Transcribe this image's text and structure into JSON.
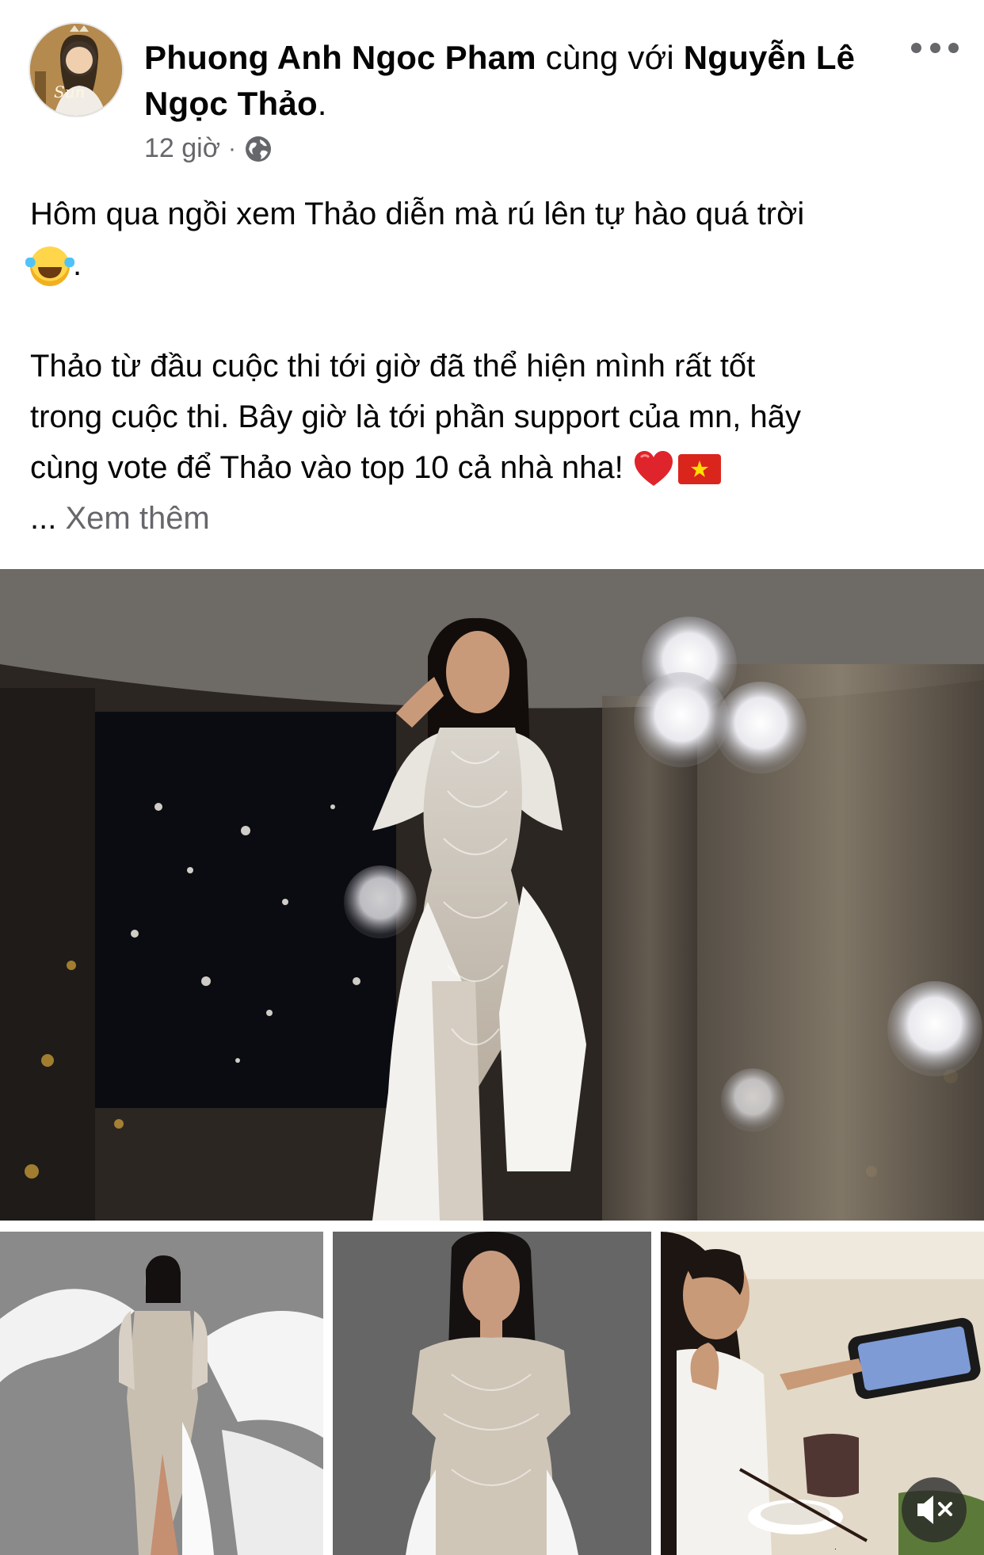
{
  "post": {
    "author": "Phuong Anh Ngoc Pham",
    "with_text": "cùng với",
    "tagged_line1": "Nguyễn Lê",
    "tagged_line2": "Ngọc Thảo",
    "tagged_suffix": ".",
    "time": "12 giờ",
    "separator": "·",
    "privacy_icon": "globe-icon",
    "more_icon": "more-options-icon",
    "avatar_text": "Sun",
    "text_line1": "Hôm qua ngồi xem Thảo diễn mà rú lên tự hào quá trời",
    "text_line1_end": ".",
    "text_line2": "Thảo từ đầu cuộc thi tới giờ đã thể hiện mình rất tốt",
    "text_line3": "trong cuộc thi. Bây giờ là tới phần support của mn, hãy",
    "text_line4": "cùng vote để Thảo vào top 10 cả nhà nha! ",
    "ellipsis": "...",
    "see_more": "Xem thêm",
    "emojis": [
      "face-with-tears-of-joy",
      "red-heart",
      "vietnam-flag"
    ],
    "mute_icon": "muted-speaker-icon"
  },
  "colors": {
    "text": "#050505",
    "secondary": "#65676b",
    "flag_red": "#da251d",
    "flag_star": "#ffde00"
  }
}
